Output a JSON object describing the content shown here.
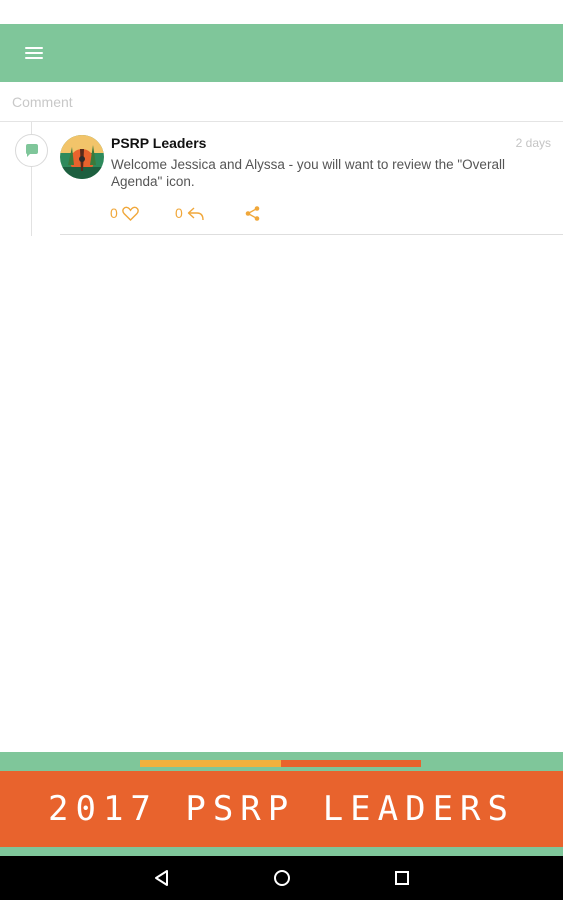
{
  "comment": {
    "placeholder": "Comment"
  },
  "post": {
    "author": "PSRP Leaders",
    "time": "2 days",
    "text": "Welcome Jessica and Alyssa - you will want to review the \"Overall Agenda\" icon.",
    "likes": "0",
    "replies": "0"
  },
  "banner": {
    "title": "2017 PSRP LEADERS"
  },
  "colors": {
    "app_bar": "#7fc69a",
    "accent": "#f0a73a",
    "banner_orange": "#e8632d",
    "banner_yellow": "#f2b13d"
  },
  "icons": {
    "menu": "hamburger-menu-icon",
    "timeline": "chat-bubble-icon",
    "like": "heart-icon",
    "reply": "reply-icon",
    "share": "share-icon",
    "nav_back": "back-triangle-icon",
    "nav_home": "home-circle-icon",
    "nav_recent": "recent-square-icon"
  }
}
